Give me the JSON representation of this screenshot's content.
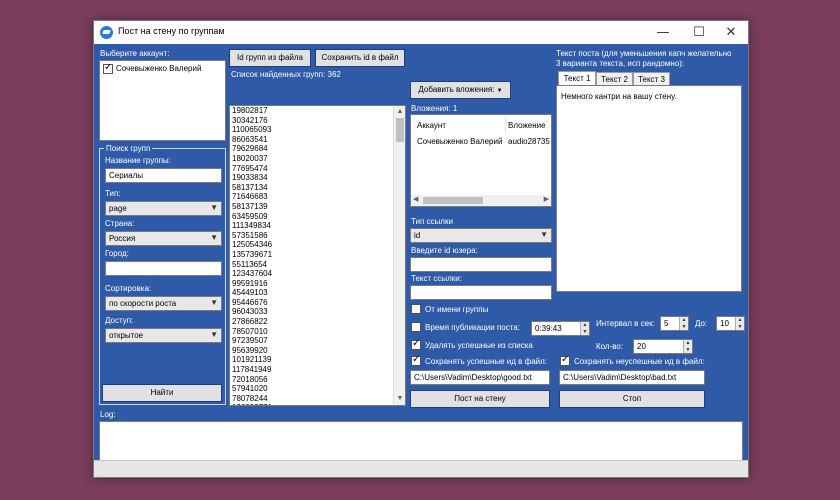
{
  "window": {
    "title": "Пост на стену по группам",
    "minimize_glyph": "—",
    "maximize_glyph": "☐",
    "close_glyph": "✕"
  },
  "account": {
    "label": "Выберите аккаунт:",
    "items": [
      {
        "name": "Сочевыженко Валерий",
        "checked": true
      }
    ]
  },
  "group_search": {
    "legend": "Поиск групп",
    "name_label": "Название группы:",
    "name_value": "Сериалы",
    "type_label": "Тип:",
    "type_value": "page",
    "country_label": "Страна:",
    "country_value": "Россия",
    "city_label": "Город:",
    "city_value": "",
    "sort_label": "Сортировка:",
    "sort_value": "по скорости роста",
    "access_label": "Доступ:",
    "access_value": "открытое",
    "find_button": "Найти"
  },
  "ids": {
    "load_button": "Id групп из файла",
    "save_button": "Сохранить id в файл",
    "found_label": "Список найденных групп: 362",
    "list": [
      "19802817",
      "30342176",
      "110065093",
      "86063541",
      "79629684",
      "18020037",
      "77695474",
      "19033834",
      "58137134",
      "71646683",
      "58137139",
      "63459509",
      "111349834",
      "57351586",
      "125054346",
      "135739671",
      "55113654",
      "123437604",
      "99591916",
      "45449103",
      "95446676",
      "96043033",
      "27866822",
      "78507010",
      "97239507",
      "95639920",
      "101921139",
      "117841949",
      "72018056",
      "57941020",
      "78078244"
    ],
    "partial_row": "136092771"
  },
  "attachments": {
    "add_button": "Добавить вложения:",
    "count_label": "Вложения: 1",
    "col_account": "Аккаунт",
    "col_attachment": "Вложение",
    "rows": [
      {
        "account": "Сочевыженко Валерий",
        "attachment": "audio28735"
      }
    ]
  },
  "link": {
    "type_label": "Тип ссылки",
    "type_value": "id",
    "user_id_label": "Введите id юзера:",
    "user_id_value": "",
    "text_label": "Текст ссылки:",
    "text_value": ""
  },
  "post_text": {
    "label_line1": "Текст поста (для уменьшения капч желательно",
    "label_line2": "3 варианта текста, исп рандомно):",
    "tabs": [
      "Текст 1",
      "Текст 2",
      "Текст 3"
    ],
    "content": "Немного кантри на вашу стену."
  },
  "options": {
    "from_group_label": "От имени группы",
    "from_group_checked": false,
    "publish_time_label": "Время публикации поста:",
    "publish_time_checked": false,
    "publish_time_value": "0:39:43",
    "delete_success_label": "Удалять успешные из списка",
    "delete_success_checked": true,
    "save_success_label": "Сохранять успешные ид в файл:",
    "save_success_checked": true,
    "save_success_path": "C:\\Users\\Vadim\\Desktop\\good.txt",
    "save_fail_label": "Сохранять неуспешные ид в файл:",
    "save_fail_checked": true,
    "save_fail_path": "C:\\Users\\Vadim\\Desktop\\bad.txt",
    "interval_label": "Интервал в сек:",
    "interval_value": "5",
    "to_label": "До:",
    "to_value": "10",
    "count_label": "Кол-во:",
    "count_value": "20"
  },
  "actions": {
    "post_button": "Пост на стену",
    "stop_button": "Стоп"
  },
  "log": {
    "label": "Log:",
    "content": ""
  }
}
